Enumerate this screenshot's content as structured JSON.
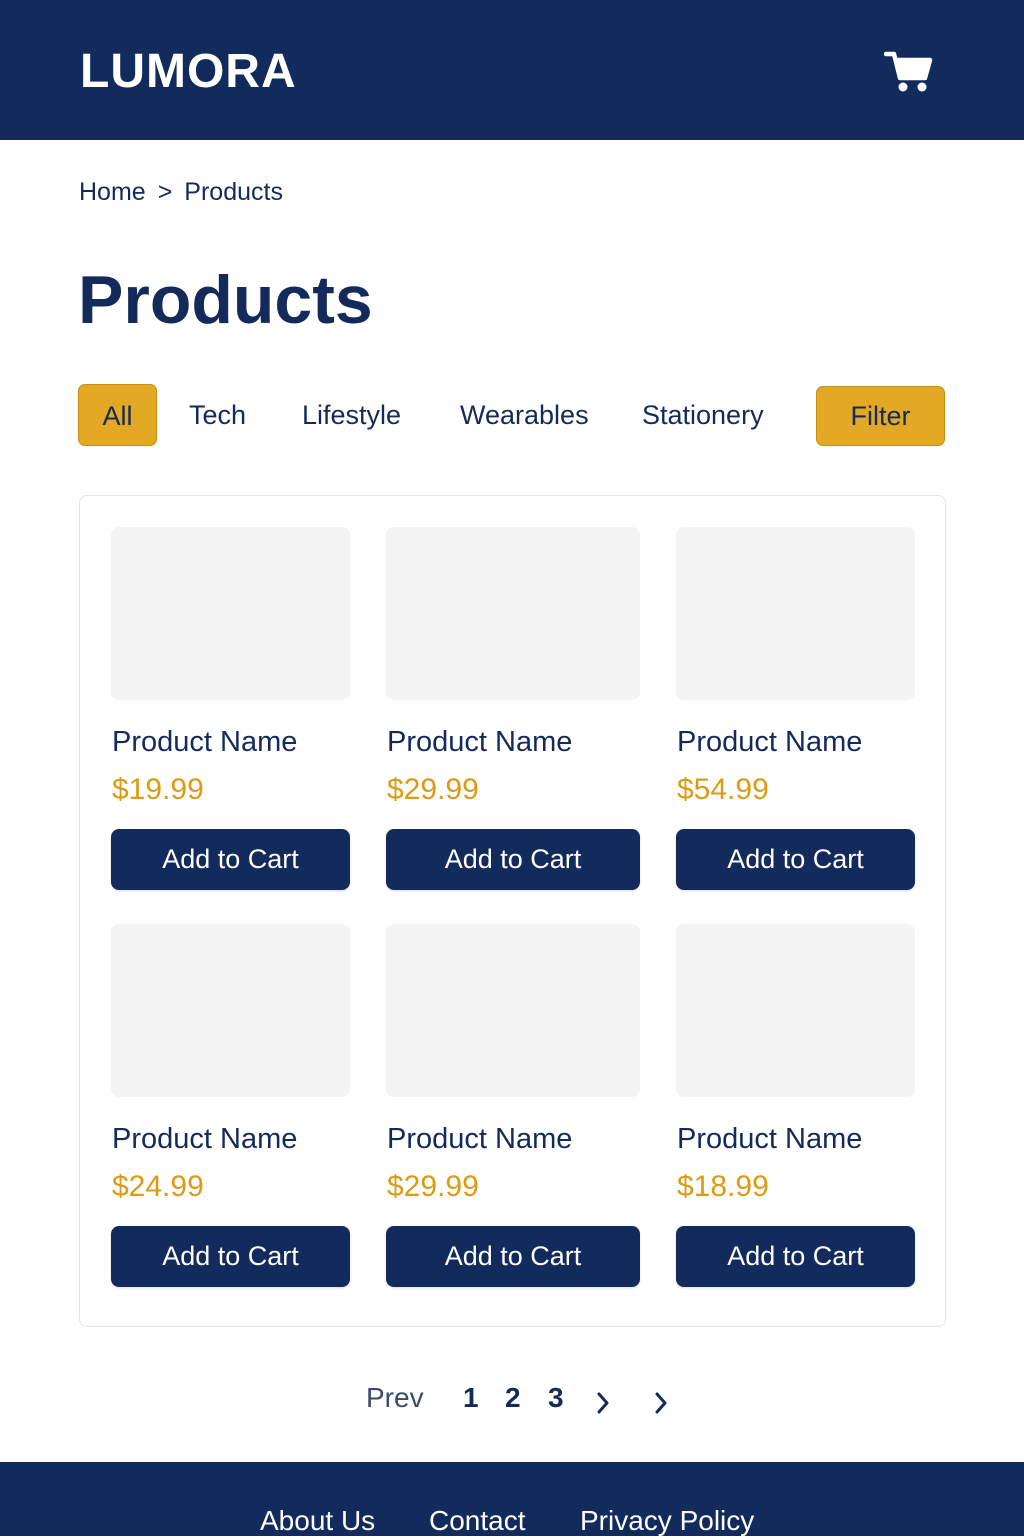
{
  "header": {
    "brand": "LUMORA",
    "cart_icon": "shopping-cart-icon",
    "background_color": "#122b5c"
  },
  "breadcrumb": {
    "items": [
      "Home",
      "Products"
    ],
    "separator": ">"
  },
  "page_title": "Products",
  "category_tabs": [
    {
      "label": "All",
      "active": true
    },
    {
      "label": "Tech",
      "active": false
    },
    {
      "label": "Lifestyle",
      "active": false
    },
    {
      "label": "Wearables",
      "active": false
    },
    {
      "label": "Stationery",
      "active": false
    }
  ],
  "filter_button": "Filter",
  "accent_color": "#e3a824",
  "price_color": "#dc9b14",
  "products": [
    {
      "name": "Product Name",
      "price": "$19.99",
      "button": "Add to Cart"
    },
    {
      "name": "Product Name",
      "price": "$29.99",
      "button": "Add to Cart"
    },
    {
      "name": "Product Name",
      "price": "$54.99",
      "button": "Add to Cart"
    },
    {
      "name": "Product Name",
      "price": "$24.99",
      "button": "Add to Cart"
    },
    {
      "name": "Product Name",
      "price": "$29.99",
      "button": "Add to Cart"
    },
    {
      "name": "Product Name",
      "price": "$18.99",
      "button": "Add to Cart"
    }
  ],
  "pagination": {
    "prev": "Prev",
    "pages": [
      "1",
      "2",
      "3"
    ],
    "next_icon": "chevron-right-icon"
  },
  "footer": {
    "links": [
      "About Us",
      "Contact",
      "Privacy Policy"
    ]
  }
}
